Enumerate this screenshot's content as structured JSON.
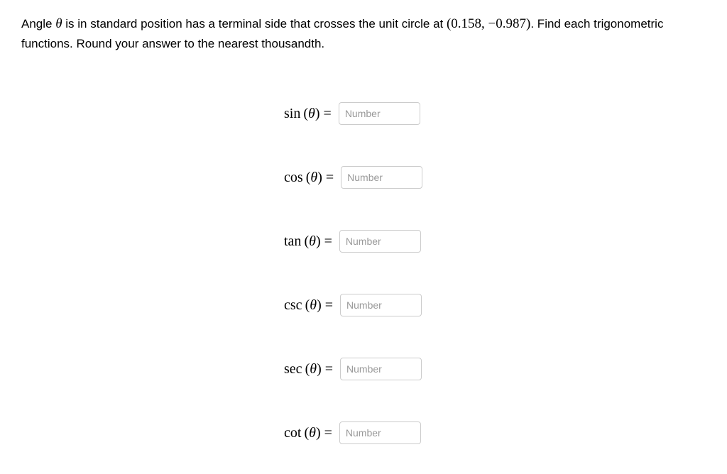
{
  "question": {
    "prefix": "Angle ",
    "theta": "θ",
    "mid1": " is in standard position has a terminal side that crosses the unit circle at ",
    "coord": "(0.158, −0.987)",
    "mid2": ". Find each trigonometric functions. Round your answer to the nearest thousandth."
  },
  "functions": [
    {
      "name": "sin",
      "placeholder": "Number"
    },
    {
      "name": "cos",
      "placeholder": "Number"
    },
    {
      "name": "tan",
      "placeholder": "Number"
    },
    {
      "name": "csc",
      "placeholder": "Number"
    },
    {
      "name": "sec",
      "placeholder": "Number"
    },
    {
      "name": "cot",
      "placeholder": "Number"
    }
  ],
  "labels": {
    "theta_arg": "(θ)",
    "equals": " = "
  }
}
